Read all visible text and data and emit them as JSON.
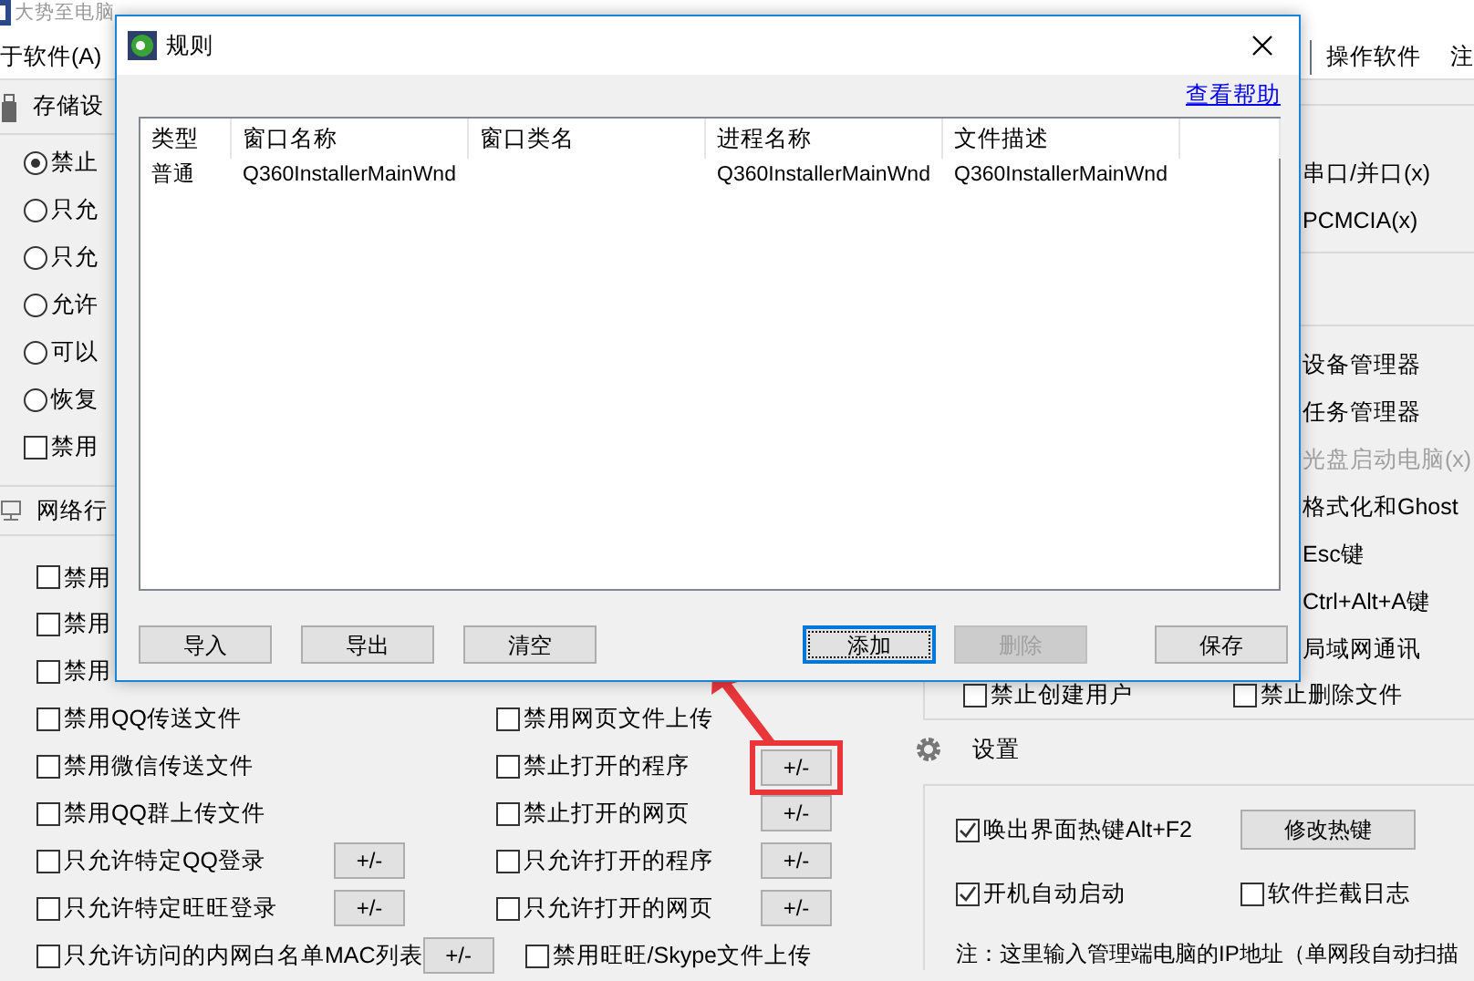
{
  "main_window": {
    "title": "大势至电脑",
    "menu_left": [
      "于软件(A)"
    ],
    "menu_right": [
      "操作软件",
      "注"
    ]
  },
  "storage": {
    "title": "存储设",
    "options": [
      {
        "kind": "radio",
        "label": "禁止",
        "checked": true
      },
      {
        "kind": "radio",
        "label": "只允",
        "checked": false
      },
      {
        "kind": "radio",
        "label": "只允",
        "checked": false
      },
      {
        "kind": "radio",
        "label": "允许",
        "checked": false
      },
      {
        "kind": "radio",
        "label": "可以",
        "checked": false
      },
      {
        "kind": "radio",
        "label": "恢复",
        "checked": false
      },
      {
        "kind": "checkbox",
        "label": "禁用",
        "checked": false
      }
    ]
  },
  "network": {
    "title": "网络行",
    "rows": [
      {
        "left": {
          "label": "禁用",
          "checked": false
        }
      },
      {
        "left": {
          "label": "禁用",
          "checked": false
        }
      },
      {
        "left": {
          "label": "禁用",
          "checked": false
        }
      },
      {
        "left": {
          "label": "禁用QQ传送文件",
          "checked": false
        },
        "right": {
          "label": "禁用网页文件上传",
          "checked": false
        }
      },
      {
        "left": {
          "label": "禁用微信传送文件",
          "checked": false
        },
        "right": {
          "label": "禁止打开的程序",
          "checked": false,
          "button": {
            "label": "+/-",
            "highlighted": true
          }
        }
      },
      {
        "left": {
          "label": "禁用QQ群上传文件",
          "checked": false
        },
        "right": {
          "label": "禁止打开的网页",
          "checked": false,
          "button": {
            "label": "+/-",
            "highlighted": false
          }
        }
      },
      {
        "left": {
          "label": "只允许特定QQ登录",
          "checked": false,
          "button": {
            "label": "+/-",
            "highlighted": false
          }
        },
        "right": {
          "label": "只允许打开的程序",
          "checked": false,
          "button": {
            "label": "+/-",
            "highlighted": false
          }
        }
      },
      {
        "left": {
          "label": "只允许特定旺旺登录",
          "checked": false,
          "button": {
            "label": "+/-",
            "highlighted": false
          }
        },
        "right": {
          "label": "只允许打开的网页",
          "checked": false,
          "button": {
            "label": "+/-",
            "highlighted": false
          }
        }
      },
      {
        "left": {
          "label": "只允许访问的内网白名单MAC列表",
          "checked": false,
          "button": {
            "label": "+/-",
            "highlighted": false
          }
        },
        "right": {
          "label": "禁用旺旺/Skype文件上传",
          "checked": false
        }
      }
    ]
  },
  "right_panel": {
    "ports": [
      {
        "label": "串口/并口(x)",
        "disabled": false
      },
      {
        "label": "PCMCIA(x)",
        "disabled": false
      }
    ],
    "system": [
      {
        "label": "设备管理器",
        "disabled": false
      },
      {
        "label": "任务管理器",
        "disabled": false
      },
      {
        "label": "光盘启动电脑(x)",
        "disabled": true
      },
      {
        "label": "格式化和Ghost",
        "disabled": false
      },
      {
        "label": "Esc键",
        "disabled": false
      },
      {
        "label": "Ctrl+Alt+A键",
        "disabled": false
      },
      {
        "label": "局域网通讯",
        "disabled": false
      }
    ],
    "extra": [
      {
        "label": "禁止创建用户",
        "checked": false
      },
      {
        "label": "禁止删除文件",
        "checked": false
      }
    ]
  },
  "settings": {
    "title": "设置",
    "hotkey": {
      "label": "唤出界面热键Alt+F2",
      "checked": true
    },
    "hotkey_button": "修改热键",
    "autostart": {
      "label": "开机自动启动",
      "checked": true
    },
    "log": {
      "label": "软件拦截日志",
      "checked": false
    },
    "note": "注：这里输入管理端电脑的IP地址（单网段自动扫描"
  },
  "dialog": {
    "title": "规则",
    "help_link": "查看帮助",
    "columns": [
      "类型",
      "窗口名称",
      "窗口类名",
      "进程名称",
      "文件描述"
    ],
    "rows": [
      {
        "type": "普通",
        "window_name": "Q360InstallerMainWnd",
        "process_name": "Q360InstallerMainWnd",
        "file_description": "Q360InstallerMainWnd"
      }
    ],
    "left_buttons": [
      {
        "label": "导入",
        "disabled": false,
        "focused": false
      },
      {
        "label": "导出",
        "disabled": false,
        "focused": false
      },
      {
        "label": "清空",
        "disabled": false,
        "focused": false
      }
    ],
    "right_buttons": [
      {
        "label": "添加",
        "disabled": false,
        "focused": true
      },
      {
        "label": "删除",
        "disabled": true,
        "focused": false
      },
      {
        "label": "保存",
        "disabled": false,
        "focused": false
      }
    ]
  }
}
